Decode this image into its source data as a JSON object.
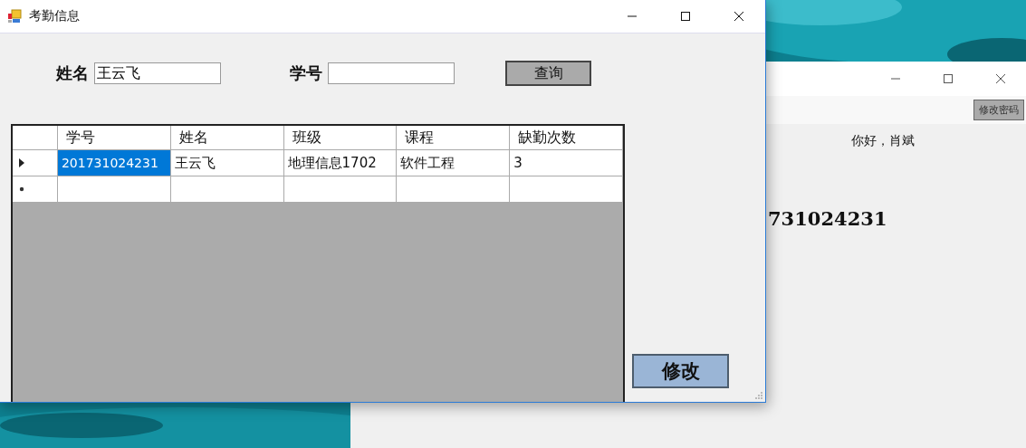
{
  "back_window": {
    "button": "修改密码",
    "greeting": "你好，肖斌",
    "id_text": "731024231"
  },
  "window": {
    "title": "考勤信息"
  },
  "fields": [
    {
      "label": "姓名",
      "value": "王云飞"
    },
    {
      "label": "学号"
    }
  ],
  "query_button": "查询",
  "table": {
    "columns": [
      "学号",
      "姓名",
      "班级",
      "课程",
      "缺勤次数"
    ],
    "rows": [
      {
        "kind": "data",
        "current": true,
        "cells": [
          {
            "text": "201731024231",
            "selected": true
          },
          {
            "text": "王云飞",
            "selected": false
          },
          {
            "text": "地理信息1702",
            "selected": false
          },
          {
            "text": "软件工程",
            "selected": false
          },
          {
            "text": "3",
            "selected": false
          }
        ]
      },
      {
        "kind": "new",
        "current": false
      }
    ]
  },
  "edit_button": "修改"
}
